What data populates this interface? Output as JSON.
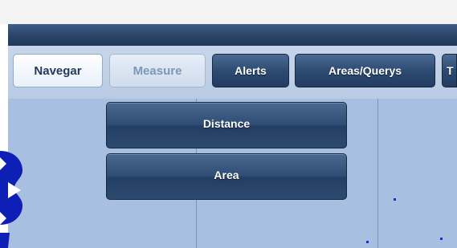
{
  "tabs": [
    {
      "label": "Navegar"
    },
    {
      "label": "Measure"
    },
    {
      "label": "Alerts"
    },
    {
      "label": "Areas/Querys"
    },
    {
      "label": "T"
    }
  ],
  "measure_menu": {
    "items": [
      {
        "label": "Distance"
      },
      {
        "label": "Area"
      }
    ]
  },
  "colors": {
    "toolbar_bg": "#c7d6ea",
    "map_bg": "#a9bfe1",
    "dark_button": "#2e4b72",
    "marker": "#1b2fd0"
  }
}
